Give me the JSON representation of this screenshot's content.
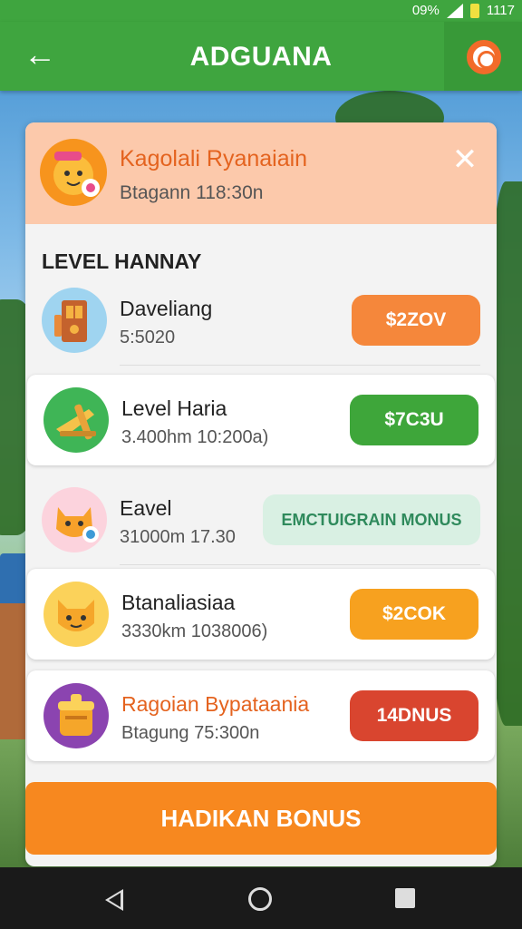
{
  "status_bar": {
    "left_text": "09%",
    "right_text": "1117"
  },
  "app_bar": {
    "title": "ADGUANA"
  },
  "notification": {
    "title": "Kagolali Ryanaiain",
    "time": "Btagann 118:30n"
  },
  "section_title": "LEVEL HANNAY",
  "items": [
    {
      "name": "Daveliang",
      "sub": "5:5020",
      "button": "$2ZOV",
      "button_color": "#f5873b"
    },
    {
      "name": "Level Haria",
      "sub": "3.400hm 10:200a)",
      "button": "$7C3U",
      "button_color": "#3ea63a"
    },
    {
      "name": "Eavel",
      "sub": "31000m 17.30",
      "button": "EMCTUIGRAIN MONUS",
      "button_color": "#d9f0e3"
    },
    {
      "name": "Btanaliasiaa",
      "sub": "3330km 1038006)",
      "button": "$2COK",
      "button_color": "#f7a11f"
    },
    {
      "name": "Ragoian Bypataania",
      "sub": "Btagung 75:300n",
      "button": "14DNUS",
      "button_color": "#d9452f"
    }
  ],
  "cta_button": "HADIKAN BONUS",
  "colors": {
    "brand_green": "#3fa53f",
    "accent_orange": "#f7881f"
  }
}
